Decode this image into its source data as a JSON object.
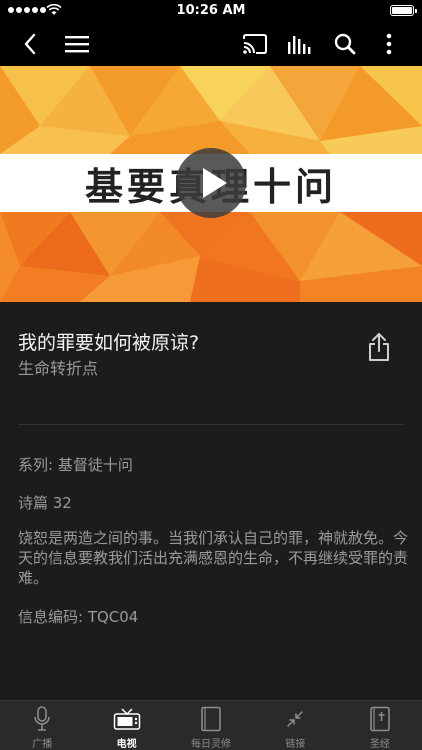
{
  "status_bar": {
    "time": "10:26 AM"
  },
  "nav": {
    "icons": [
      "back-icon",
      "menu-icon",
      "cast-icon",
      "audio-bars-icon",
      "search-icon",
      "more-icon"
    ]
  },
  "hero": {
    "banner_text": "基要真理十问"
  },
  "episode": {
    "title": "我的罪要如何被原谅?",
    "program": "生命转折点",
    "series": "系列: 基督徒十问",
    "scripture": "诗篇 32",
    "description": "饶恕是两造之间的事。当我们承认自己的罪，神就赦免。今天的信息要教我们活出充满感恩的生命，不再继续受罪的责难。",
    "code": "信息编码: TQC04"
  },
  "tabs": [
    {
      "label": "广播",
      "icon": "microphone-icon",
      "active": false
    },
    {
      "label": "电视",
      "icon": "tv-icon",
      "active": true
    },
    {
      "label": "每日灵修",
      "icon": "book-icon",
      "active": false
    },
    {
      "label": "链接",
      "icon": "link-icon",
      "active": false
    },
    {
      "label": "圣经",
      "icon": "bible-icon",
      "active": false
    }
  ],
  "colors": {
    "background": "#1c1c1e",
    "hero_orange": "#f5a025",
    "tab_active": "#ffffff",
    "tab_inactive": "#8e8e8e"
  }
}
